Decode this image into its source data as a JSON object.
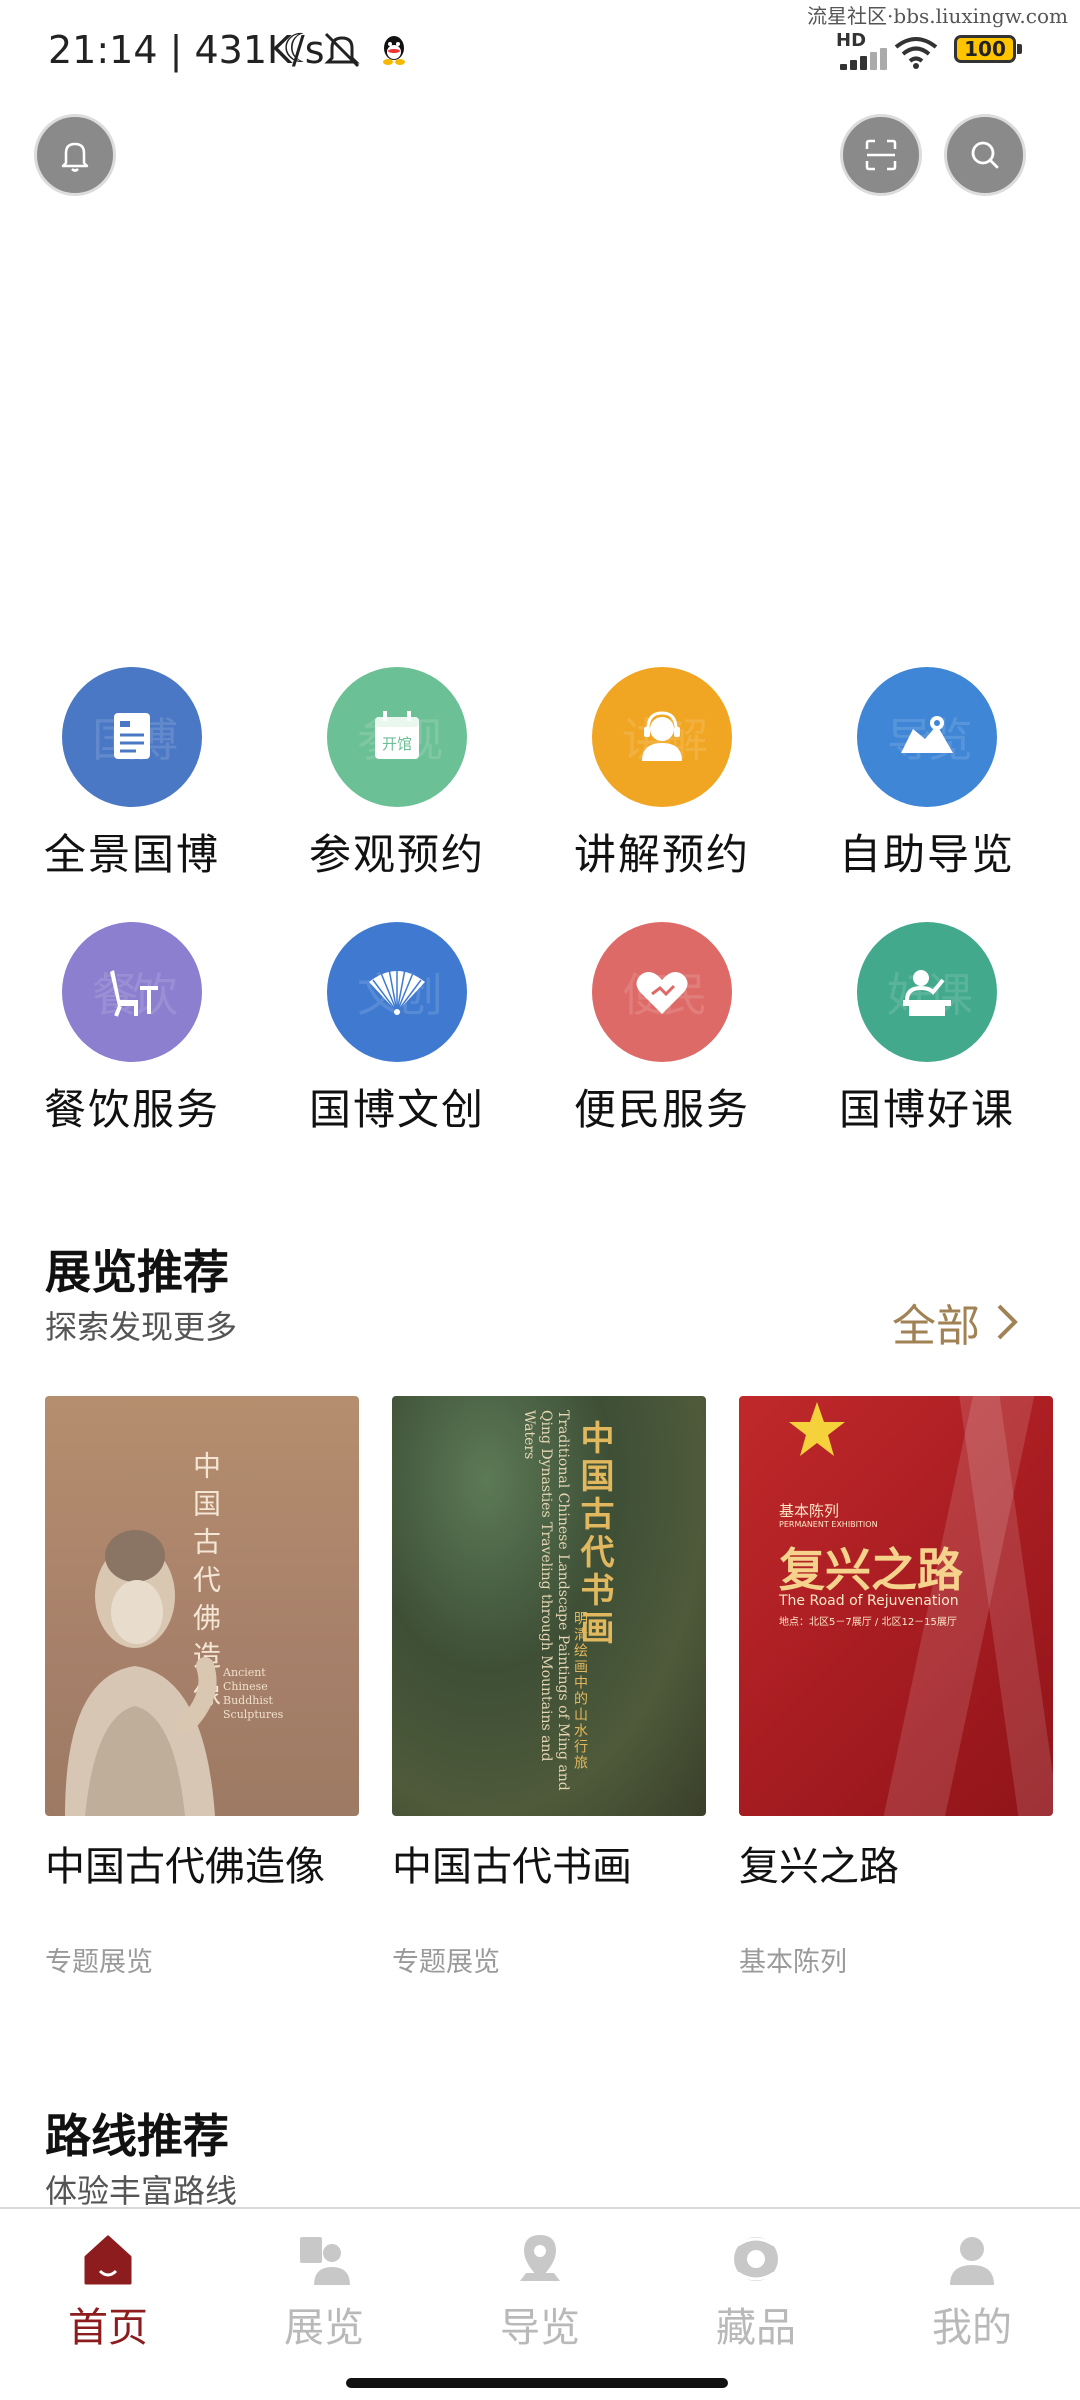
{
  "status_bar": {
    "time_speed": "21:14 | 431K/s",
    "network_type": "HD",
    "battery": "100",
    "watermark": "流星社区·bbs.liuxingw.com"
  },
  "top_actions": {
    "left_icon": "bell-icon",
    "right_icons": [
      "scan-icon",
      "search-icon"
    ]
  },
  "services": [
    {
      "label": "全景国博",
      "color": "#4a78c4",
      "icon": "document-icon",
      "ghost": "国博"
    },
    {
      "label": "参观预约",
      "color": "#6cc096",
      "icon": "calendar-open-icon",
      "badge": "开馆",
      "ghost": "参观"
    },
    {
      "label": "讲解预约",
      "color": "#f0a623",
      "icon": "guide-person-icon",
      "ghost": "讲解"
    },
    {
      "label": "自助导览",
      "color": "#3f86d6",
      "icon": "map-icon",
      "ghost": "导览"
    },
    {
      "label": "餐饮服务",
      "color": "#8c7fcf",
      "icon": "dining-chair-icon",
      "ghost": "餐饮"
    },
    {
      "label": "国博文创",
      "color": "#3f7ad0",
      "icon": "fan-icon",
      "ghost": "文创"
    },
    {
      "label": "便民服务",
      "color": "#dd6a67",
      "icon": "heart-hands-icon",
      "ghost": "便民"
    },
    {
      "label": "国博好课",
      "color": "#42a98c",
      "icon": "lecture-icon",
      "ghost": "好课"
    }
  ],
  "exhibition_section": {
    "title": "展览推荐",
    "subtitle": "探索发现更多",
    "all_label": "全部",
    "accent": "#a08254",
    "items": [
      {
        "name": "中国古代佛造像",
        "type": "专题展览",
        "poster": {
          "title": "中国古代佛造像",
          "english": "Ancient Chinese Buddhist Sculptures"
        }
      },
      {
        "name": "中国古代书画",
        "type": "专题展览",
        "poster": {
          "title": "中国古代书画",
          "subtitle": "明清绘画中的山水行旅",
          "english": "Traditional Chinese Landscape Paintings of Ming and Qing Dynasties Traveling through Mountains and Waters"
        }
      },
      {
        "name": "复兴之路",
        "type": "基本陈列",
        "poster": {
          "series": "基本陈列",
          "series_en": "PERMANENT EXHIBITION",
          "title": "复兴之路",
          "english": "The Road of Rejuvenation",
          "location": "地点：北区5－7展厅 / 北区12－15展厅"
        }
      }
    ]
  },
  "route_section": {
    "title": "路线推荐",
    "subtitle": "体验丰富路线"
  },
  "bottom_nav": {
    "active_color": "#8d1c1e",
    "inactive_color": "#b9b9b9",
    "items": [
      {
        "label": "首页",
        "icon": "home-icon",
        "active": true
      },
      {
        "label": "展览",
        "icon": "exhibition-icon",
        "active": false
      },
      {
        "label": "导览",
        "icon": "location-pin-icon",
        "active": false
      },
      {
        "label": "藏品",
        "icon": "collection-icon",
        "active": false
      },
      {
        "label": "我的",
        "icon": "profile-icon",
        "active": false
      }
    ]
  }
}
